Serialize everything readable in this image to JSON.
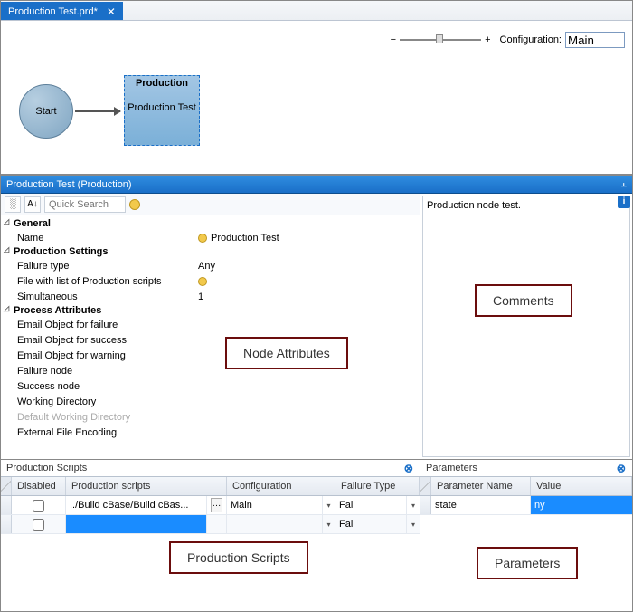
{
  "tab": {
    "title": "Production Test.prd*",
    "close_glyph": "✕"
  },
  "canvas": {
    "zoom_minus": "−",
    "zoom_plus": "+",
    "config_label": "Configuration:",
    "config_value": "Main",
    "start_label": "Start",
    "prod_header": "Production",
    "prod_body": "Production Test"
  },
  "section_header": {
    "title": "Production Test (Production)",
    "pin": "⫠"
  },
  "toolbar": {
    "categorized_glyph": "░",
    "sort_glyph": "A↓",
    "search_placeholder": "Quick Search"
  },
  "groups": {
    "general": "General",
    "prod_settings": "Production Settings",
    "proc_attrs": "Process Attributes"
  },
  "props": {
    "name_k": "Name",
    "name_v": "Production Test",
    "failure_type_k": "Failure type",
    "failure_type_v": "Any",
    "file_list_k": "File with list of Production scripts",
    "simultaneous_k": "Simultaneous",
    "simultaneous_v": "1",
    "email_fail_k": "Email Object for failure",
    "email_succ_k": "Email Object for success",
    "email_warn_k": "Email Object for warning",
    "failure_node_k": "Failure node",
    "success_node_k": "Success node",
    "workdir_k": "Working Directory",
    "def_workdir_k": "Default Working Directory",
    "ext_enc_k": "External File Encoding"
  },
  "comments": {
    "text": "Production node test."
  },
  "callouts": {
    "attrs": "Node Attributes",
    "comments": "Comments",
    "scripts": "Production Scripts",
    "params": "Parameters"
  },
  "scripts": {
    "title": "Production Scripts",
    "cols": {
      "disabled": "Disabled",
      "scripts": "Production scripts",
      "config": "Configuration",
      "ftype": "Failure Type"
    },
    "rows": [
      {
        "disabled": false,
        "script": "../Build cBase/Build cBas...",
        "config": "Main",
        "ftype": "Fail"
      },
      {
        "disabled": false,
        "script": "",
        "config": "",
        "ftype": "Fail"
      }
    ]
  },
  "params": {
    "title": "Parameters",
    "cols": {
      "name": "Parameter Name",
      "value": "Value"
    },
    "rows": [
      {
        "name": "state",
        "value": "ny",
        "selected": true
      }
    ]
  }
}
